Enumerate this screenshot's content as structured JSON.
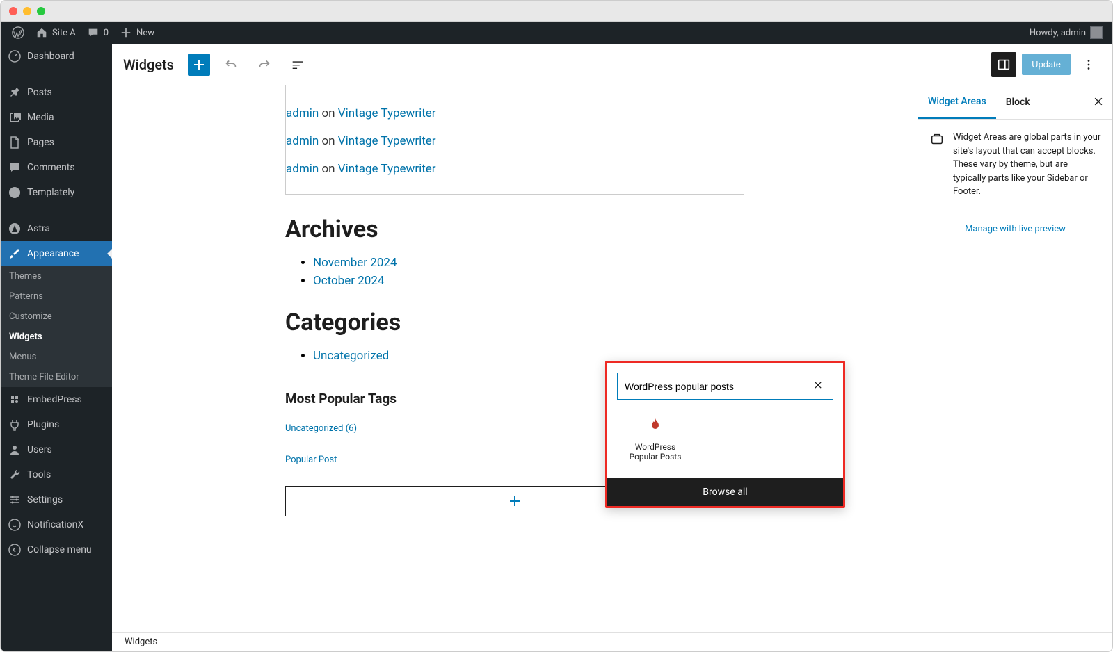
{
  "adminbar": {
    "site_name": "Site A",
    "comment_count": "0",
    "new_label": "New",
    "howdy": "Howdy, admin"
  },
  "sidebar": {
    "items": [
      {
        "label": "Dashboard",
        "icon": "dashboard"
      },
      {
        "label": "Posts",
        "icon": "pin"
      },
      {
        "label": "Media",
        "icon": "media"
      },
      {
        "label": "Pages",
        "icon": "page"
      },
      {
        "label": "Comments",
        "icon": "comment"
      },
      {
        "label": "Templately",
        "icon": "templately"
      },
      {
        "label": "Astra",
        "icon": "astra"
      },
      {
        "label": "Appearance",
        "icon": "brush",
        "active": true
      },
      {
        "label": "EmbedPress",
        "icon": "embed"
      },
      {
        "label": "Plugins",
        "icon": "plug"
      },
      {
        "label": "Users",
        "icon": "user"
      },
      {
        "label": "Tools",
        "icon": "wrench"
      },
      {
        "label": "Settings",
        "icon": "settings"
      },
      {
        "label": "NotificationX",
        "icon": "notif"
      },
      {
        "label": "Collapse menu",
        "icon": "collapse"
      }
    ],
    "submenu": [
      {
        "label": "Themes"
      },
      {
        "label": "Patterns"
      },
      {
        "label": "Customize"
      },
      {
        "label": "Widgets",
        "current": true
      },
      {
        "label": "Menus"
      },
      {
        "label": "Theme File Editor"
      }
    ]
  },
  "editor": {
    "title": "Widgets",
    "update_label": "Update"
  },
  "canvas": {
    "comments": [
      {
        "author": "admin",
        "on": " on ",
        "post": "Vintage Typewriter"
      },
      {
        "author": "admin",
        "on": " on ",
        "post": "Vintage Typewriter"
      },
      {
        "author": "admin",
        "on": " on ",
        "post": "Vintage Typewriter"
      }
    ],
    "archives_heading": "Archives",
    "archives": [
      "November 2024",
      "October 2024"
    ],
    "categories_heading": "Categories",
    "categories": [
      "Uncategorized"
    ],
    "popular_tags_heading": "Most Popular Tags",
    "tag1": "Uncategorized  (6)",
    "tag2": "Popular Post"
  },
  "inserter": {
    "search_value": "WordPress popular posts",
    "result_label": "WordPress Popular Posts",
    "browse_all": "Browse all"
  },
  "settings": {
    "tab_widget_areas": "Widget Areas",
    "tab_block": "Block",
    "description": "Widget Areas are global parts in your site's layout that can accept blocks. These vary by theme, but are typically parts like your Sidebar or Footer.",
    "manage_link": "Manage with live preview"
  },
  "footer": {
    "breadcrumb": "Widgets"
  }
}
